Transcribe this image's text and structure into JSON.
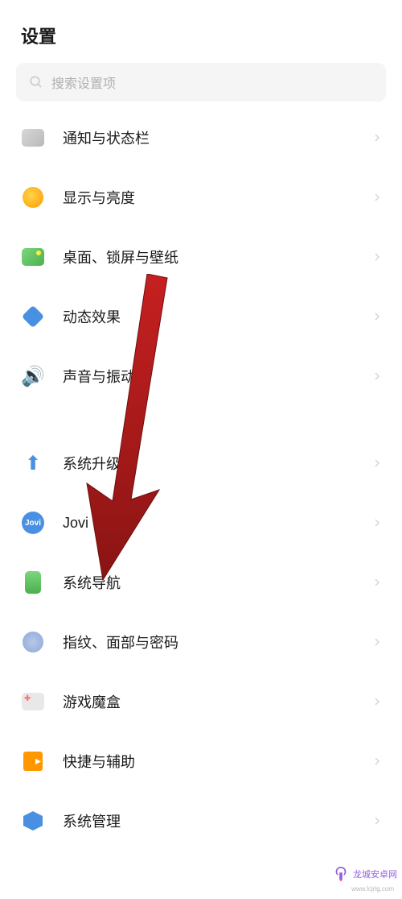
{
  "header": {
    "title": "设置"
  },
  "search": {
    "placeholder": "搜索设置项"
  },
  "groups": [
    {
      "items": [
        {
          "icon": "notification-icon",
          "label": "通知与状态栏"
        },
        {
          "icon": "display-icon",
          "label": "显示与亮度"
        },
        {
          "icon": "wallpaper-icon",
          "label": "桌面、锁屏与壁纸"
        },
        {
          "icon": "dynamic-icon",
          "label": "动态效果"
        },
        {
          "icon": "sound-icon",
          "label": "声音与振动"
        }
      ]
    },
    {
      "items": [
        {
          "icon": "upgrade-icon",
          "label": "系统升级"
        },
        {
          "icon": "jovi-icon",
          "label": "Jovi"
        },
        {
          "icon": "navigation-icon",
          "label": "系统导航"
        },
        {
          "icon": "fingerprint-icon",
          "label": "指纹、面部与密码"
        },
        {
          "icon": "gamebox-icon",
          "label": "游戏魔盒"
        },
        {
          "icon": "shortcut-icon",
          "label": "快捷与辅助"
        },
        {
          "icon": "system-icon",
          "label": "系统管理"
        }
      ]
    }
  ],
  "annotation": {
    "arrow_color": "#a81c1c",
    "target_item": "系统导航"
  },
  "watermark": {
    "text": "龙城安卓网",
    "sub": "www.lcjrlg.com"
  }
}
